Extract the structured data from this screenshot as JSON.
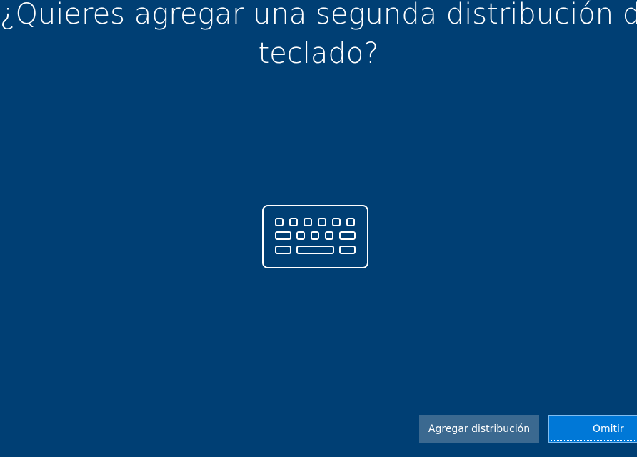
{
  "setup": {
    "title_line1": "¿Quieres agregar una segunda distribución de",
    "title_line2": "teclado?",
    "illustration_icon": "keyboard-icon"
  },
  "actions": {
    "add_layout_label": "Agregar distribución",
    "skip_label": "Omitir"
  },
  "colors": {
    "background": "#003f74",
    "secondary_button": "#3b6990",
    "primary_button": "#0078d7",
    "text": "#ffffff"
  }
}
